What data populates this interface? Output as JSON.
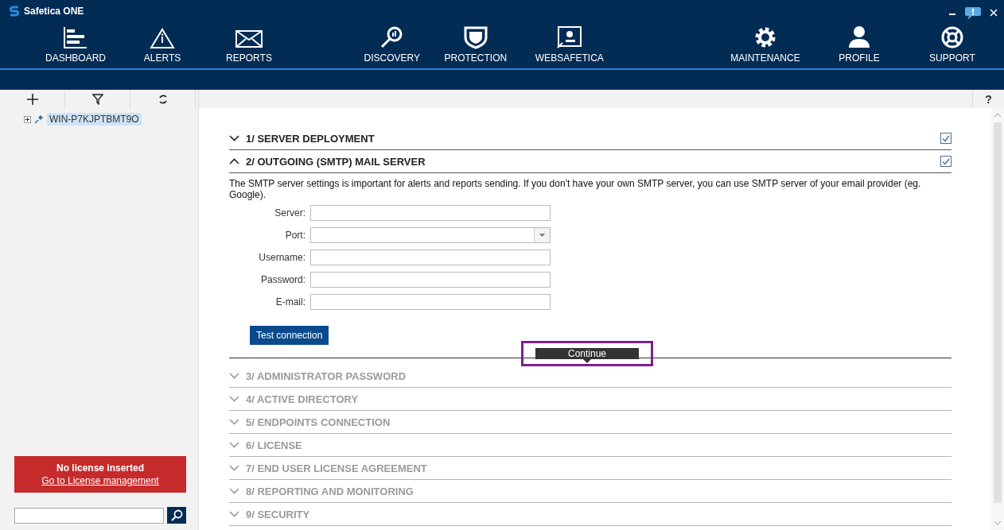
{
  "window": {
    "title": "Safetica ONE"
  },
  "nav_groups": [
    [
      {
        "label": "DASHBOARD"
      },
      {
        "label": "ALERTS"
      },
      {
        "label": "REPORTS"
      }
    ],
    [
      {
        "label": "DISCOVERY"
      },
      {
        "label": "PROTECTION"
      },
      {
        "label": "WEBSAFETICA"
      }
    ],
    [
      {
        "label": "MAINTENANCE"
      },
      {
        "label": "PROFILE"
      },
      {
        "label": "SUPPORT"
      }
    ]
  ],
  "sidebar": {
    "tree": [
      {
        "label": "WIN-P7KJPTBMT9O",
        "selected": true,
        "expanded": false
      }
    ],
    "license": {
      "title": "No license inserted",
      "link": "Go to License management"
    }
  },
  "help": "?",
  "sections": [
    {
      "title": "1/ SERVER DEPLOYMENT",
      "expanded": false,
      "checked": true,
      "disabled": false
    },
    {
      "title": "2/ OUTGOING (SMTP) MAIL SERVER",
      "expanded": true,
      "checked": true,
      "disabled": false,
      "description": "The SMTP server settings is important for alerts and reports sending. If you don't have your own SMTP server, you can use SMTP server of your email provider (eg. Google).",
      "fields": [
        {
          "label": "Server:",
          "kind": "text"
        },
        {
          "label": "Port:",
          "kind": "select"
        },
        {
          "label": "Username:",
          "kind": "text"
        },
        {
          "label": "Password:",
          "kind": "password"
        },
        {
          "label": "E-mail:",
          "kind": "text"
        }
      ],
      "button": "Test connection",
      "continue": "Continue"
    },
    {
      "title": "3/ ADMINISTRATOR PASSWORD",
      "expanded": false,
      "disabled": true
    },
    {
      "title": "4/ ACTIVE DIRECTORY",
      "expanded": false,
      "disabled": true
    },
    {
      "title": "5/ ENDPOINTS CONNECTION",
      "expanded": false,
      "disabled": true
    },
    {
      "title": "6/ LICENSE",
      "expanded": false,
      "disabled": true
    },
    {
      "title": "7/ END USER LICENSE AGREEMENT",
      "expanded": false,
      "disabled": true
    },
    {
      "title": "8/ REPORTING AND MONITORING",
      "expanded": false,
      "disabled": true
    },
    {
      "title": "9/ SECURITY",
      "expanded": false,
      "disabled": true
    }
  ]
}
